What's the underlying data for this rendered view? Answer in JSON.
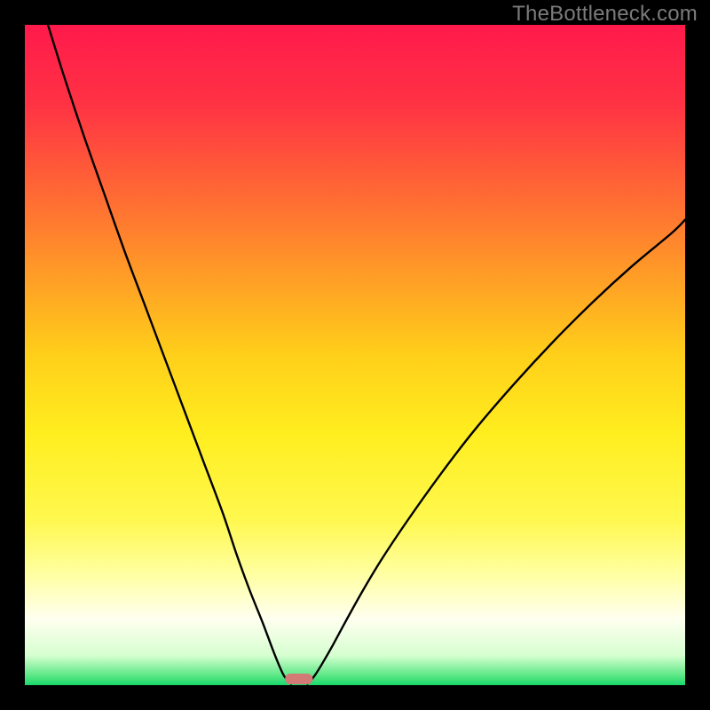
{
  "watermark": "TheBottleneck.com",
  "chart_data": {
    "type": "line",
    "title": "",
    "xlabel": "",
    "ylabel": "",
    "xlim": [
      0,
      100
    ],
    "ylim": [
      0,
      100
    ],
    "gradient_stops": [
      {
        "offset": 0.0,
        "color": "#ff1a4b"
      },
      {
        "offset": 0.12,
        "color": "#ff3244"
      },
      {
        "offset": 0.3,
        "color": "#ff7b2f"
      },
      {
        "offset": 0.5,
        "color": "#ffcf1a"
      },
      {
        "offset": 0.62,
        "color": "#ffee1f"
      },
      {
        "offset": 0.75,
        "color": "#fff84f"
      },
      {
        "offset": 0.83,
        "color": "#ffffa0"
      },
      {
        "offset": 0.9,
        "color": "#fffff0"
      },
      {
        "offset": 0.955,
        "color": "#d6ffd0"
      },
      {
        "offset": 0.985,
        "color": "#5ee887"
      },
      {
        "offset": 1.0,
        "color": "#18d86a"
      }
    ],
    "series": [
      {
        "name": "bottleneck-curve-left",
        "x": [
          3.5,
          6,
          9,
          12,
          15,
          18,
          21,
          24,
          27,
          30,
          32,
          34,
          36,
          37.5,
          38.5,
          39.2,
          39.8,
          40.3
        ],
        "y": [
          100,
          92,
          83,
          74.5,
          66,
          58,
          50,
          42,
          34,
          26,
          20,
          14.5,
          9.5,
          5.5,
          3.0,
          1.5,
          0.7,
          0.2
        ]
      },
      {
        "name": "bottleneck-curve-right",
        "x": [
          42.8,
          43.3,
          44.0,
          45,
          46.5,
          48.5,
          51,
          54,
          58,
          63,
          68,
          74,
          80,
          86,
          92,
          98,
          100
        ],
        "y": [
          0.2,
          0.7,
          1.6,
          3.2,
          5.8,
          9.5,
          14,
          19,
          25,
          32,
          38.5,
          45.5,
          52,
          58,
          63.5,
          68.5,
          70.5
        ]
      }
    ],
    "marker": {
      "name": "optimal-marker",
      "x": 41.5,
      "width": 4.2,
      "color": "#d47a76"
    }
  }
}
